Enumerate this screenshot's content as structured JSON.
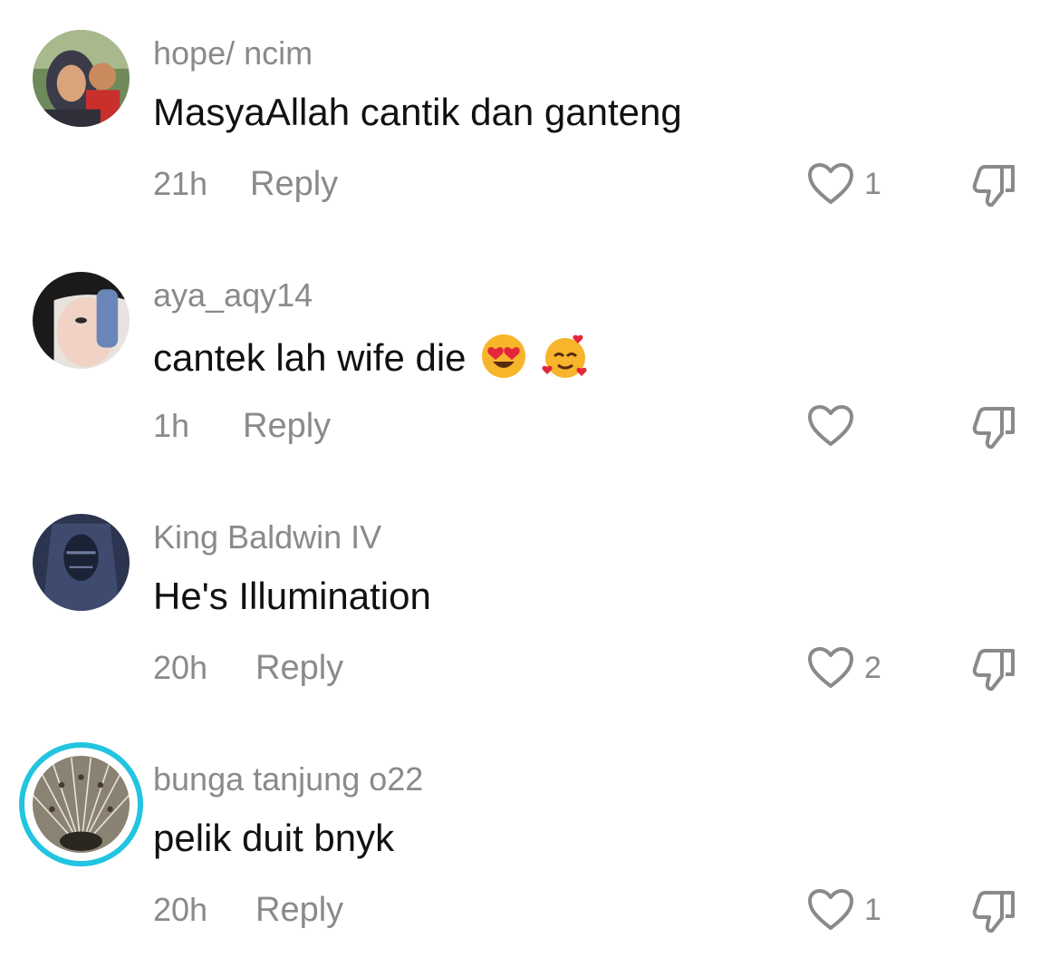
{
  "comments": [
    {
      "username": "hope/ ncim",
      "text": "MasyaAllah cantik dan ganteng",
      "time": "21h",
      "reply_label": "Reply",
      "likes": "1"
    },
    {
      "username": "aya_aqy14",
      "text": "cantek lah wife die",
      "emojis": [
        "heart-eyes-emoji",
        "smiling-face-with-hearts-emoji"
      ],
      "time": "1h",
      "reply_label": "Reply",
      "likes": ""
    },
    {
      "username": "King Baldwin IV",
      "text": "He's Illumination",
      "time": "20h",
      "reply_label": "Reply",
      "likes": "2"
    },
    {
      "username": "bunga tanjung o22",
      "text": "pelik duit bnyk",
      "time": "20h",
      "reply_label": "Reply",
      "likes": "1",
      "story_ring_color": "#22c4e0"
    }
  ],
  "colors": {
    "secondary_text": "#8a8a8a",
    "primary_text": "#111111",
    "icon_stroke": "#8a8a8a"
  }
}
